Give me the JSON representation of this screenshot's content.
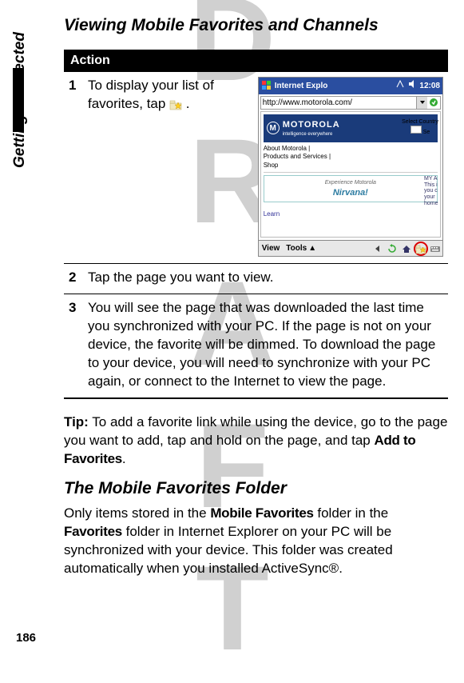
{
  "watermark": "DRAFT",
  "side_label": "Getting Connected",
  "heading1": "Viewing Mobile Favorites and Channels",
  "table": {
    "header": "Action",
    "rows": [
      {
        "num": "1",
        "text_before_icon": "To display your list of favorites, tap ",
        "text_after_icon": " ."
      },
      {
        "num": "2",
        "text": "Tap the page you want to view."
      },
      {
        "num": "3",
        "text": "You will see the page that was downloaded the last time you synchronized with your PC. If the page is not on your device, the favorite will be dimmed. To download the page to your device, you will need to synchronize with your PC again, or connect to the Internet to view the page."
      }
    ]
  },
  "screenshot": {
    "titlebar_text": "Internet Explo",
    "clock": "12:08",
    "url": "http://www.motorola.com/",
    "logo_text": "MOTOROLA",
    "logo_sub": "intelligence everywhere",
    "select_country_label": "Select Country",
    "select_country_btn": "Se",
    "menu_items": "About Motorola  |\nProducts and Services  |\nShop",
    "nirvana_sub": "Experience Motorola",
    "nirvana_main": "Nirvana!",
    "right_frag": "MY A\nThis i\nyou c\nyour\nhome",
    "bottom_links": "Learn",
    "bottom_view": "View",
    "bottom_tools": "Tools"
  },
  "tip": {
    "label": "Tip:",
    "text": " To add a favorite link while using the device, go to the page you want to add, tap and hold on the page, and tap ",
    "bold_tail": "Add to Favorites",
    "tail": "."
  },
  "heading2": "The Mobile Favorites Folder",
  "body": {
    "p1a": "Only items stored in the ",
    "p1b": "Mobile Favorites",
    "p1c": " folder in the ",
    "p1d": "Favorites",
    "p1e": " folder in Internet Explorer on your PC will be synchronized with your device. This folder was created automatically when you installed ActiveSync®."
  },
  "page_number": "186"
}
